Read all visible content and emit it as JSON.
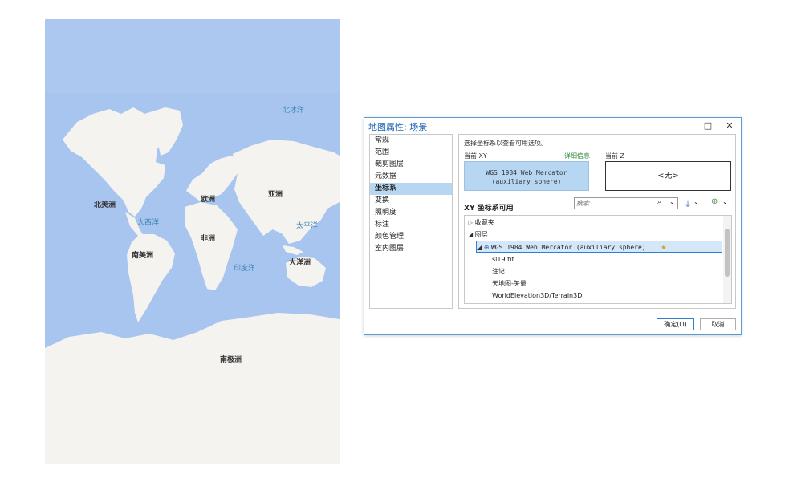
{
  "map": {
    "colors": {
      "ocean": "#a7c5ee",
      "land": "#f5f3ef",
      "ice": "#f5f3ef"
    },
    "continents": [
      "北冰洋",
      "北美洲",
      "欧洲",
      "亚洲",
      "非洲",
      "南美洲",
      "大洋洲",
      "南极洲"
    ],
    "oceans": [
      "大西洋",
      "太平洋",
      "印度洋"
    ]
  },
  "dialog": {
    "title": "地图属性: 场景",
    "window_buttons": {
      "maximize": "□",
      "close": "✕"
    },
    "nav_items": [
      "常规",
      "范围",
      "裁剪图层",
      "元数据",
      "坐标系",
      "变换",
      "照明度",
      "标注",
      "颜色管理",
      "室内图层"
    ],
    "selected_nav": "坐标系",
    "content": {
      "instruction": "选择坐标系以查看可用选项。",
      "current_xy_label": "当前 XY",
      "details_link": "详细信息",
      "current_z_label": "当前 Z",
      "current_xy_value_line1": "WGS 1984 Web Mercator",
      "current_xy_value_line2": "(auxiliary sphere)",
      "current_z_value": "<无>",
      "available_heading": "XY 坐标系可用",
      "search_placeholder": "搜索",
      "tree": {
        "favorites": "收藏夹",
        "layers": "图层",
        "selected_cs": "WGS 1984 Web Mercator (auxiliary sphere)",
        "children": [
          "sl19.tif",
          "注记",
          "天地图-矢量",
          "WorldElevation3D/Terrain3D"
        ]
      }
    },
    "ok_button": "确定(O)",
    "cancel_button": "取消",
    "accent_color": "#2f7fd0"
  }
}
